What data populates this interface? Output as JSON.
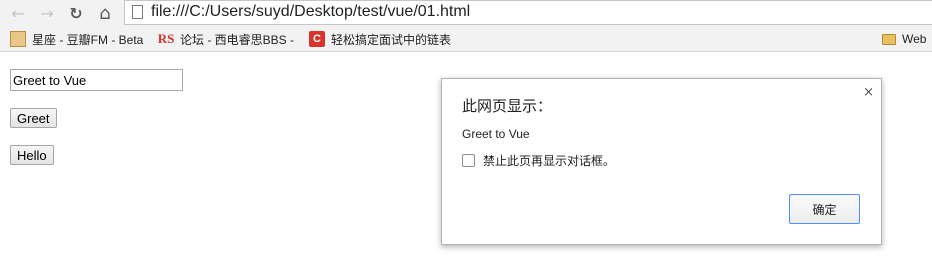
{
  "browser": {
    "url": "file:///C:/Users/suyd/Desktop/test/vue/01.html",
    "nav": {
      "back_icon": "←",
      "forward_icon": "→",
      "reload_icon": "↻",
      "home_icon": "⌂"
    }
  },
  "bookmarks": [
    {
      "label": "星座 - 豆瓣FM - Beta",
      "icon": "douban-icon",
      "glyph": ""
    },
    {
      "label": "论坛 - 西电睿思BBS -",
      "icon": "rs-icon",
      "glyph": "RS"
    },
    {
      "label": "轻松搞定面试中的链表",
      "icon": "c-icon",
      "glyph": "C"
    },
    {
      "label": "Web",
      "icon": "folder-icon",
      "glyph": ""
    }
  ],
  "page": {
    "input_value": "Greet to Vue",
    "greet_button": "Greet",
    "hello_button": "Hello"
  },
  "dialog": {
    "title": "此网页显示：",
    "close_glyph": "×",
    "message": "Greet to Vue",
    "suppress_label": "禁止此页再显示对话框。",
    "ok_label": "确定"
  }
}
